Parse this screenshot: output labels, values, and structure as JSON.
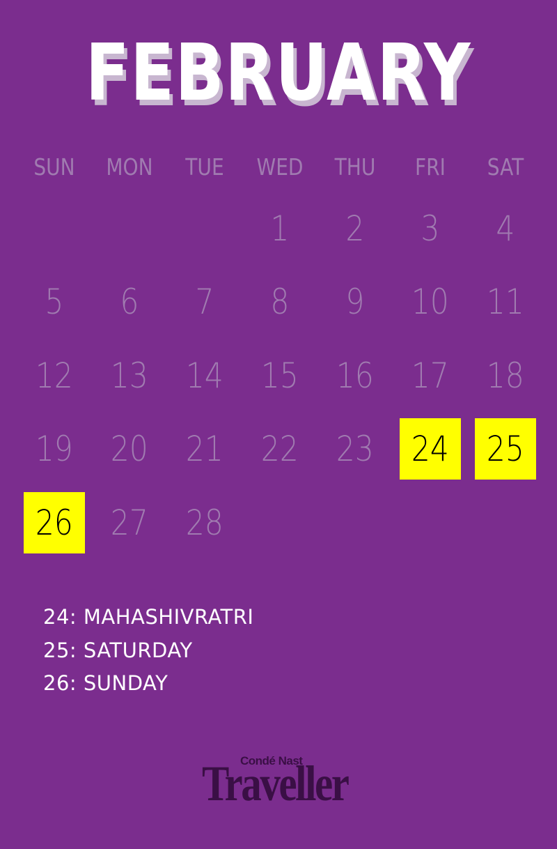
{
  "month": "FEBRUARY",
  "weekdays": [
    "SUN",
    "MON",
    "TUE",
    "WED",
    "THU",
    "FRI",
    "SAT"
  ],
  "weeks": [
    [
      null,
      null,
      null,
      "1",
      "2",
      "3",
      "4"
    ],
    [
      "5",
      "6",
      "7",
      "8",
      "9",
      "10",
      "11"
    ],
    [
      "12",
      "13",
      "14",
      "15",
      "16",
      "17",
      "18"
    ],
    [
      "19",
      "20",
      "21",
      "22",
      "23",
      "24",
      "25"
    ],
    [
      "26",
      "27",
      "28",
      null,
      null,
      null,
      null
    ]
  ],
  "highlighted_days": [
    "24",
    "25",
    "26"
  ],
  "notes": [
    "24: MAHASHIVRATRI",
    "25: SATURDAY",
    "26: SUNDAY"
  ],
  "logo": {
    "top": "Condé Nast",
    "main": "Traveller"
  },
  "colors": {
    "background": "#7b2d8e",
    "highlight": "#ffff00",
    "muted_text": "#a07bb0",
    "logo": "#3a0f45"
  }
}
